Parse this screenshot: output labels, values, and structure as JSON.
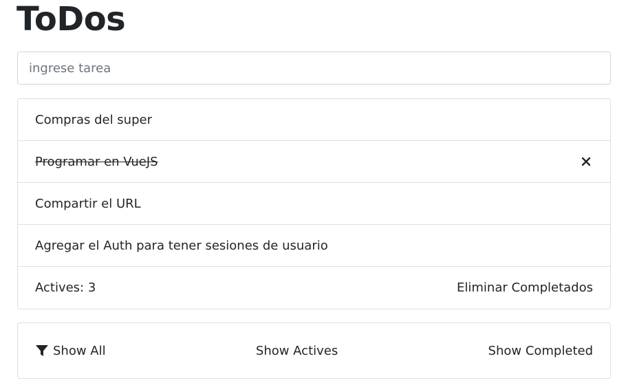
{
  "app": {
    "title": "ToDos"
  },
  "input": {
    "placeholder": "ingrese tarea",
    "value": ""
  },
  "todos": [
    {
      "text": "Compras del super",
      "completed": false
    },
    {
      "text": "Programar en VueJS",
      "completed": true
    },
    {
      "text": "Compartir el URL",
      "completed": false
    },
    {
      "text": "Agregar el Auth para tener sesiones de usuario",
      "completed": false
    }
  ],
  "footer": {
    "actives_label": "Actives: 3",
    "clear_label": "Eliminar Completados"
  },
  "filters": {
    "all_label": "Show All",
    "actives_label": "Show Actives",
    "completed_label": "Show Completed",
    "active_filter_icon": "filter-icon",
    "delete_icon": "close-icon"
  }
}
